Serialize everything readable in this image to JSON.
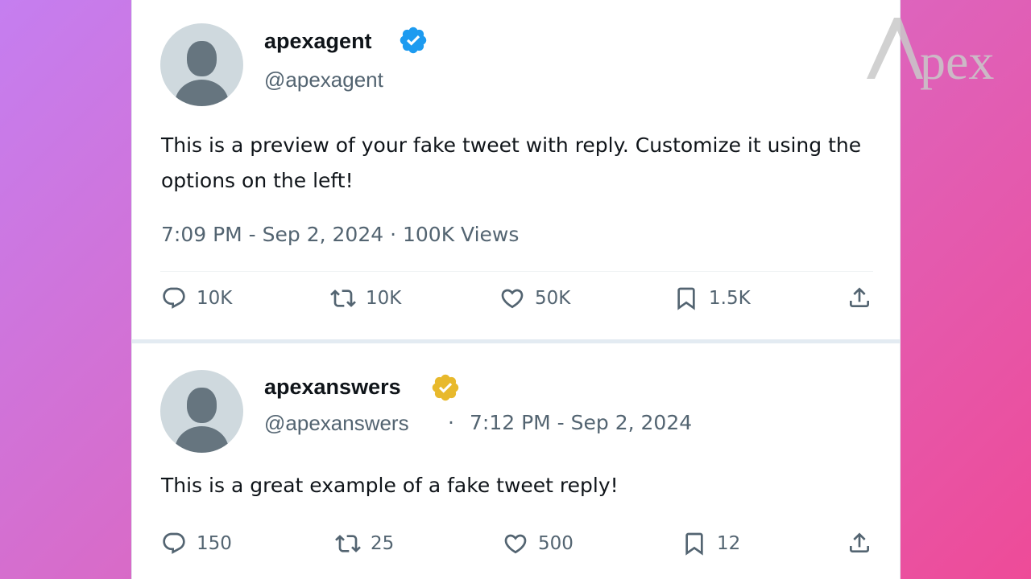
{
  "main_tweet": {
    "display_name": "apexagent",
    "handle": "@apexagent",
    "verified_color": "#1d9bf0",
    "text": "This is a preview of your fake tweet with reply. Customize it using the options on the left!",
    "time": "7:09 PM - Sep 2, 2024",
    "views": "100K Views",
    "meta_separator": " · ",
    "actions": {
      "replies": "10K",
      "retweets": "10K",
      "likes": "50K",
      "bookmarks": "1.5K"
    }
  },
  "reply_tweet": {
    "display_name": "apexanswers",
    "handle": "@apexanswers",
    "verified_color": "#e8b92c",
    "meta_separator": "·",
    "time": "7:12 PM - Sep 2, 2024",
    "text": "This is a great example of a fake tweet reply!",
    "actions": {
      "replies": "150",
      "retweets": "25",
      "likes": "500",
      "bookmarks": "12"
    }
  },
  "watermark": {
    "logo_text": "Apex"
  },
  "colors": {
    "text_primary": "#0f1419",
    "text_secondary": "#536471",
    "background_gradient_start": "#c57ef0",
    "background_gradient_end": "#ee4b98"
  }
}
